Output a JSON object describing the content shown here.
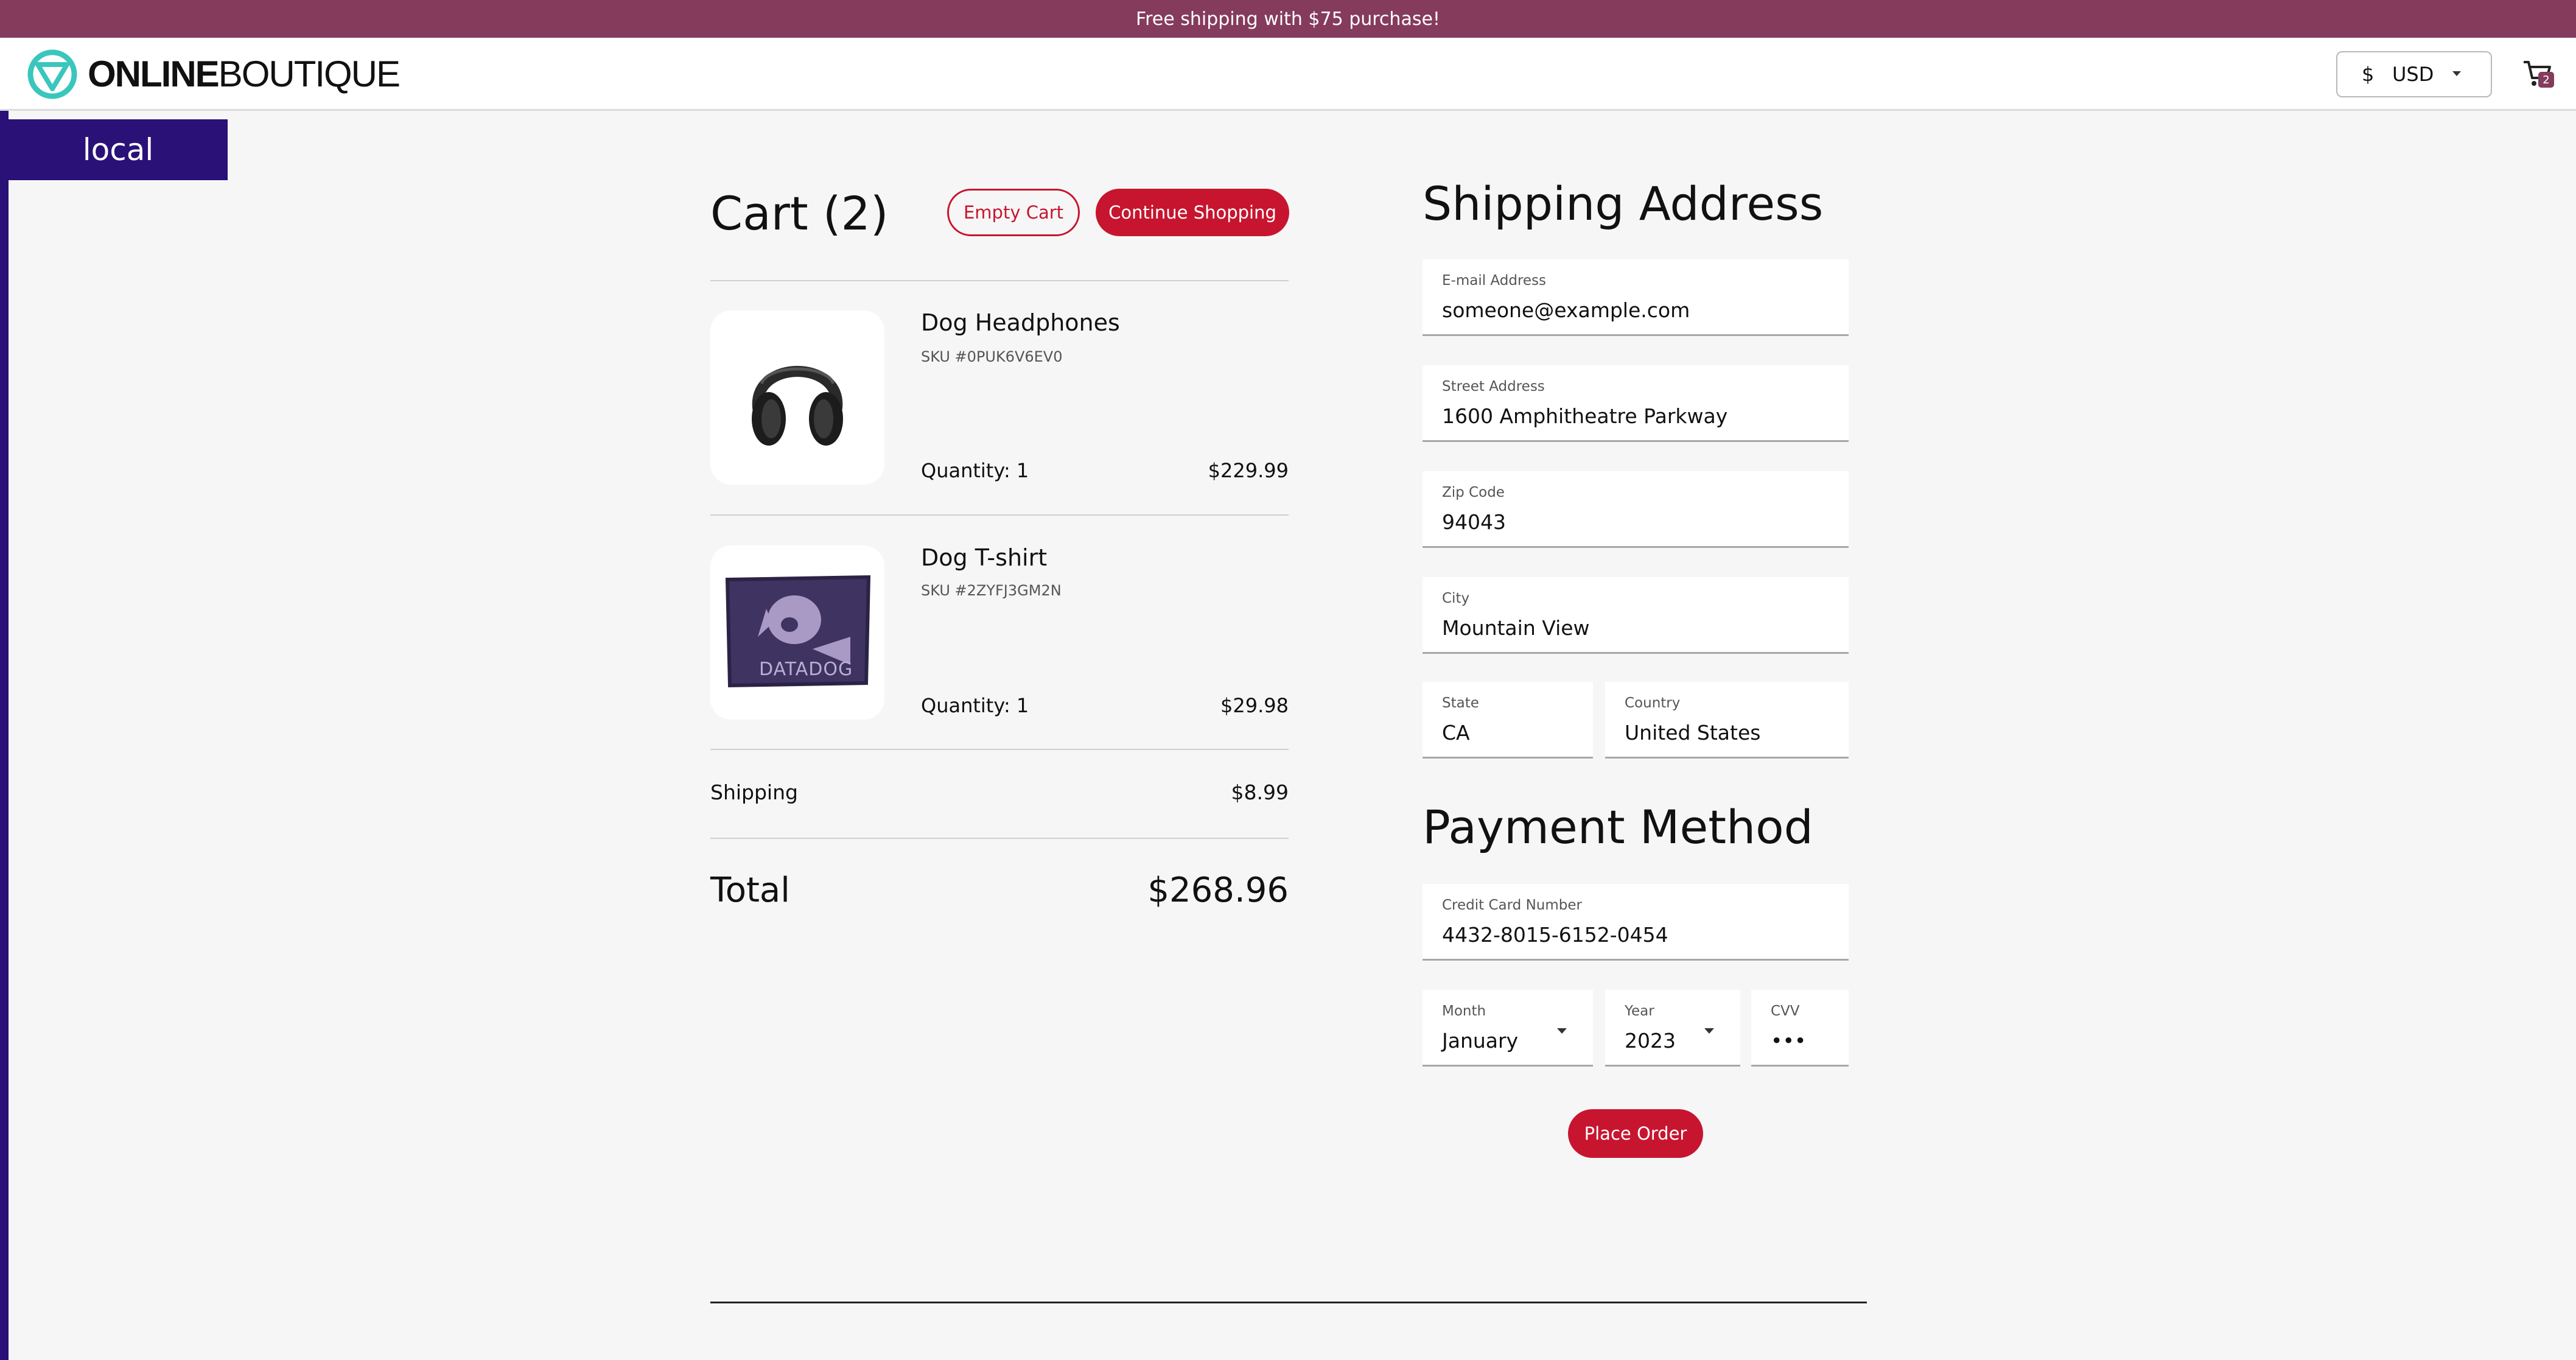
{
  "promo": {
    "text": "Free shipping with $75 purchase!"
  },
  "header": {
    "logo_bold": "ONLINE",
    "logo_light": "BOUTIQUE",
    "currency_symbol": "$",
    "currency_code": "USD",
    "cart_count": "2"
  },
  "env": {
    "label": "local"
  },
  "cart": {
    "title": "Cart (2)",
    "empty_label": "Empty Cart",
    "continue_label": "Continue Shopping",
    "items": [
      {
        "name": "Dog Headphones",
        "sku": "SKU #0PUK6V6EV0",
        "quantity": "Quantity: 1",
        "price": "$229.99",
        "image_icon": "headphones-icon"
      },
      {
        "name": "Dog T-shirt",
        "sku": "SKU #2ZYFJ3GM2N",
        "quantity": "Quantity: 1",
        "price": "$29.98",
        "image_icon": "tshirt-icon",
        "image_text": "DATADOG"
      }
    ],
    "shipping_label": "Shipping",
    "shipping_price": "$8.99",
    "total_label": "Total",
    "total_price": "$268.96"
  },
  "shipping": {
    "title": "Shipping Address",
    "email": {
      "label": "E-mail Address",
      "value": "someone@example.com"
    },
    "street": {
      "label": "Street Address",
      "value": "1600 Amphitheatre Parkway"
    },
    "zip": {
      "label": "Zip Code",
      "value": "94043"
    },
    "city": {
      "label": "City",
      "value": "Mountain View"
    },
    "state": {
      "label": "State",
      "value": "CA"
    },
    "country": {
      "label": "Country",
      "value": "United States"
    }
  },
  "payment": {
    "title": "Payment Method",
    "card": {
      "label": "Credit Card Number",
      "value": "4432-8015-6152-0454"
    },
    "month": {
      "label": "Month",
      "value": "January"
    },
    "year": {
      "label": "Year",
      "value": "2023"
    },
    "cvv": {
      "label": "CVV",
      "value": "•••"
    },
    "place_order_label": "Place Order"
  },
  "colors": {
    "promo_bg": "#853b5c",
    "accent_red": "#c7152f",
    "env_purple": "#2a1178",
    "logo_teal": "#3ac6bd"
  }
}
